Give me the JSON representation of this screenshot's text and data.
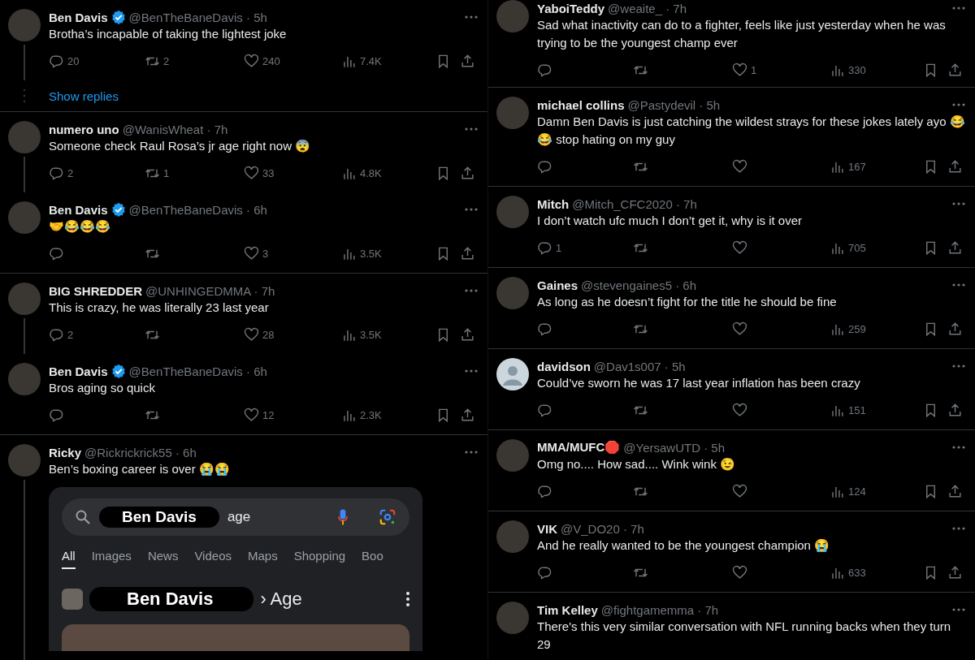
{
  "columns": [
    {
      "threads": [
        {
          "posts": [
            {
              "name": "Ben Davis",
              "verified": true,
              "meta": "@BenTheBaneDavis · 5h",
              "text": "Brotha’s incapable of taking the lightest joke",
              "default_avatar": false,
              "thread_line": true,
              "stats": {
                "replies": "20",
                "reposts": "2",
                "likes": "240",
                "views": "7.4K"
              }
            }
          ],
          "show_replies": "Show replies"
        },
        {
          "posts": [
            {
              "name": "numero uno",
              "verified": false,
              "meta": "@WanisWheat · 7h",
              "text": "Someone check Raul Rosa’s jr age right now 😨",
              "default_avatar": false,
              "thread_line": true,
              "stats": {
                "replies": "2",
                "reposts": "1",
                "likes": "33",
                "views": "4.8K"
              }
            },
            {
              "name": "Ben Davis",
              "verified": true,
              "meta": "@BenTheBaneDavis · 6h",
              "text": "🤝😂😂😂",
              "default_avatar": false,
              "thread_line": false,
              "stats": {
                "likes": "3",
                "views": "3.5K"
              }
            }
          ]
        },
        {
          "posts": [
            {
              "name": "BIG SHREDDER",
              "verified": false,
              "meta": "@UNHINGEDMMA · 7h",
              "text": "This is crazy, he was literally 23 last year",
              "default_avatar": false,
              "thread_line": true,
              "stats": {
                "replies": "2",
                "likes": "28",
                "views": "3.5K"
              }
            },
            {
              "name": "Ben Davis",
              "verified": true,
              "meta": "@BenTheBaneDavis · 6h",
              "text": "Bros aging so quick",
              "default_avatar": false,
              "thread_line": false,
              "stats": {
                "likes": "12",
                "views": "2.3K"
              }
            }
          ]
        },
        {
          "posts": [
            {
              "name": "Ricky",
              "verified": false,
              "meta": "@Rickrickrick55 · 6h",
              "text": "Ben’s boxing career is over 😭😭",
              "default_avatar": false,
              "thread_line": true,
              "embed": {
                "search_name": "Ben Davis",
                "search_query": "age",
                "tabs": [
                  {
                    "label": "All",
                    "selected": true
                  },
                  {
                    "label": "Images",
                    "selected": false
                  },
                  {
                    "label": "News",
                    "selected": false
                  },
                  {
                    "label": "Videos",
                    "selected": false
                  },
                  {
                    "label": "Maps",
                    "selected": false
                  },
                  {
                    "label": "Shopping",
                    "selected": false
                  },
                  {
                    "label": "Boo",
                    "selected": false
                  }
                ],
                "result_name": "Ben Davis",
                "result_label": "› Age"
              }
            }
          ]
        }
      ]
    },
    {
      "threads": [
        {
          "posts": [
            {
              "name": "YaboiTeddy",
              "verified": false,
              "meta": "@weaite_ · 7h",
              "text": "Sad what inactivity can do to a fighter, feels like just yesterday when he was trying to be the youngest champ ever",
              "default_avatar": false,
              "thread_line": false,
              "stats": {
                "likes": "1",
                "views": "330"
              }
            }
          ]
        },
        {
          "posts": [
            {
              "name": "michael collins",
              "verified": false,
              "meta": "@Pastydevil · 5h",
              "text": "Damn Ben Davis is just catching the wildest strays for these jokes lately ayo 😂😂 stop hating on my guy",
              "default_avatar": false,
              "thread_line": false,
              "stats": {
                "views": "167"
              }
            }
          ]
        },
        {
          "posts": [
            {
              "name": "Mitch",
              "verified": false,
              "meta": "@Mitch_CFC2020 · 7h",
              "text": "I don’t watch ufc much I don’t get it, why is it over",
              "default_avatar": false,
              "thread_line": false,
              "stats": {
                "replies": "1",
                "views": "705"
              }
            }
          ]
        },
        {
          "posts": [
            {
              "name": "Gaines",
              "verified": false,
              "meta": "@stevengaines5 · 6h",
              "text": "As long as he doesn’t fight for the title he should be fine",
              "default_avatar": false,
              "thread_line": false,
              "stats": {
                "views": "259"
              }
            }
          ]
        },
        {
          "posts": [
            {
              "name": "davidson",
              "verified": false,
              "meta": "@Dav1s007 · 5h",
              "text": "Could’ve sworn he was 17 last year inflation has been crazy",
              "default_avatar": true,
              "thread_line": false,
              "stats": {
                "views": "151"
              }
            }
          ]
        },
        {
          "posts": [
            {
              "name": "MMA/MUFC🛑",
              "verified": false,
              "meta": "@YersawUTD · 5h",
              "text": "Omg no.... How sad.... Wink wink 😉",
              "default_avatar": false,
              "thread_line": false,
              "stats": {
                "views": "124"
              }
            }
          ]
        },
        {
          "posts": [
            {
              "name": "VIK",
              "verified": false,
              "meta": "@V_DO20 · 7h",
              "text": "And he really wanted to be the youngest champion 😭",
              "default_avatar": false,
              "thread_line": false,
              "stats": {
                "views": "633"
              }
            }
          ]
        },
        {
          "posts": [
            {
              "name": "Tim Kelley",
              "verified": false,
              "meta": "@fightgamemma · 7h",
              "text": "There's this very similar conversation with NFL running backs when they turn 29",
              "default_avatar": false,
              "thread_line": false
            }
          ]
        }
      ]
    }
  ]
}
